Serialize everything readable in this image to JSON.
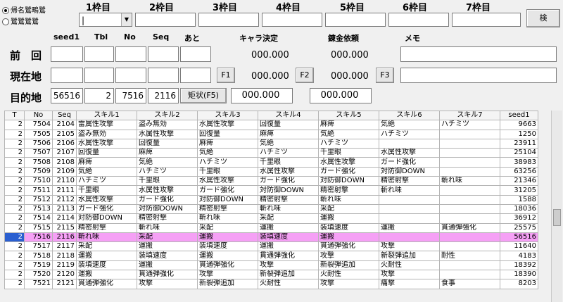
{
  "mode": {
    "option1": "帰名鷺鴫鷺",
    "option2": "鷺鷺鷺鷺"
  },
  "slots": [
    {
      "label": "1枠目",
      "value": "|"
    },
    {
      "label": "2枠目",
      "value": ""
    },
    {
      "label": "3枠目",
      "value": ""
    },
    {
      "label": "4枠目",
      "value": ""
    },
    {
      "label": "5枠目",
      "value": ""
    },
    {
      "label": "6枠目",
      "value": ""
    },
    {
      "label": "7枠目",
      "value": ""
    }
  ],
  "search_button": "検",
  "columns": {
    "seed1": "seed1",
    "tbl": "Tbl",
    "no": "No",
    "seq": "Seq",
    "ato": "あと",
    "chara": "キャラ決定",
    "renkin": "錬金依頼",
    "memo": "メモ"
  },
  "rows": {
    "prev": {
      "label": "前　回",
      "chara": "000.000",
      "renkin": "000.000"
    },
    "current": {
      "label": "現在地",
      "f1": "F1",
      "chara": "000.000",
      "f2": "F2",
      "renkin": "000.000",
      "f3": "F3"
    },
    "target": {
      "label": "目的地",
      "seed1": "56516",
      "tbl": "2",
      "no": "7516",
      "seq": "2116",
      "button": "矩状(F5)",
      "chara": "000.000",
      "renkin": "000.000"
    }
  },
  "table": {
    "headers": [
      "T",
      "No",
      "Seq",
      "スキル1",
      "スキル2",
      "スキル3",
      "スキル4",
      "スキル5",
      "スキル6",
      "スキル7",
      "seed1"
    ],
    "rows": [
      [
        "2",
        "7504",
        "2104",
        "雷属性攻撃",
        "盗み無効",
        "水属性攻撃",
        "回復量",
        "麻痺",
        "気絶",
        "ハチミツ",
        "9663"
      ],
      [
        "2",
        "7505",
        "2105",
        "盗み無効",
        "水属性攻撃",
        "回復量",
        "麻痺",
        "気絶",
        "ハチミツ",
        "",
        "1250"
      ],
      [
        "2",
        "7506",
        "2106",
        "水属性攻撃",
        "回復量",
        "麻痺",
        "気絶",
        "ハチミツ",
        "",
        "",
        "23911"
      ],
      [
        "2",
        "7507",
        "2107",
        "回復量",
        "麻痺",
        "気絶",
        "ハチミツ",
        "千里眼",
        "水属性攻撃",
        "",
        "25104"
      ],
      [
        "2",
        "7508",
        "2108",
        "麻痺",
        "気絶",
        "ハチミツ",
        "千里眼",
        "水属性攻撃",
        "ガード強化",
        "",
        "38983"
      ],
      [
        "2",
        "7509",
        "2109",
        "気絶",
        "ハチミツ",
        "千里眼",
        "水属性攻撃",
        "ガード強化",
        "対防御DOWN",
        "",
        "63256"
      ],
      [
        "2",
        "7510",
        "2110",
        "ハチミツ",
        "千里眼",
        "水属性攻撃",
        "ガード強化",
        "対防御DOWN",
        "精密射撃",
        "斬れ味",
        "21346"
      ],
      [
        "2",
        "7511",
        "2111",
        "千里眼",
        "水属性攻撃",
        "ガード強化",
        "対防御DOWN",
        "精密射撃",
        "斬れ味",
        "",
        "31205"
      ],
      [
        "2",
        "7512",
        "2112",
        "水属性攻撃",
        "ガード強化",
        "対防御DOWN",
        "精密射撃",
        "斬れ味",
        "",
        "",
        "1588"
      ],
      [
        "2",
        "7513",
        "2113",
        "ガード強化",
        "対防御DOWN",
        "精密射撃",
        "斬れ味",
        "采配",
        "",
        "",
        "18036"
      ],
      [
        "2",
        "7514",
        "2114",
        "対防御DOWN",
        "精密射撃",
        "斬れ味",
        "采配",
        "運搬",
        "",
        "",
        "36912"
      ],
      [
        "2",
        "7515",
        "2115",
        "精密射撃",
        "斬れ味",
        "采配",
        "運搬",
        "装填速度",
        "運搬",
        "貫通弾強化",
        "25575"
      ],
      [
        "2",
        "7516",
        "2116",
        "斬れ味",
        "采配",
        "運搬",
        "装填速度",
        "運搬",
        "",
        "",
        "56516"
      ],
      [
        "2",
        "7517",
        "2117",
        "采配",
        "運搬",
        "装填速度",
        "運搬",
        "貫通弾強化",
        "攻撃",
        "",
        "11640"
      ],
      [
        "2",
        "7518",
        "2118",
        "運搬",
        "装填速度",
        "運搬",
        "貫通弾強化",
        "攻撃",
        "新裂弾追加",
        "耐性",
        "4183"
      ],
      [
        "2",
        "7519",
        "2119",
        "装填速度",
        "運搬",
        "貫通弾強化",
        "攻撃",
        "新裂弾追加",
        "火耐性",
        "",
        "18392"
      ],
      [
        "2",
        "7520",
        "2120",
        "運搬",
        "貫通弾強化",
        "攻撃",
        "新裂弾追加",
        "火耐性",
        "攻撃",
        "",
        "18390"
      ],
      [
        "2",
        "7521",
        "2121",
        "貫通弾強化",
        "攻撃",
        "新裂弾追加",
        "火耐性",
        "攻撃",
        "痛撃",
        "食事",
        "8203"
      ]
    ],
    "selected_index": 12
  },
  "colors": {
    "selected_row": "#f5a0f5",
    "selected_cell": "#2a5fd0"
  }
}
